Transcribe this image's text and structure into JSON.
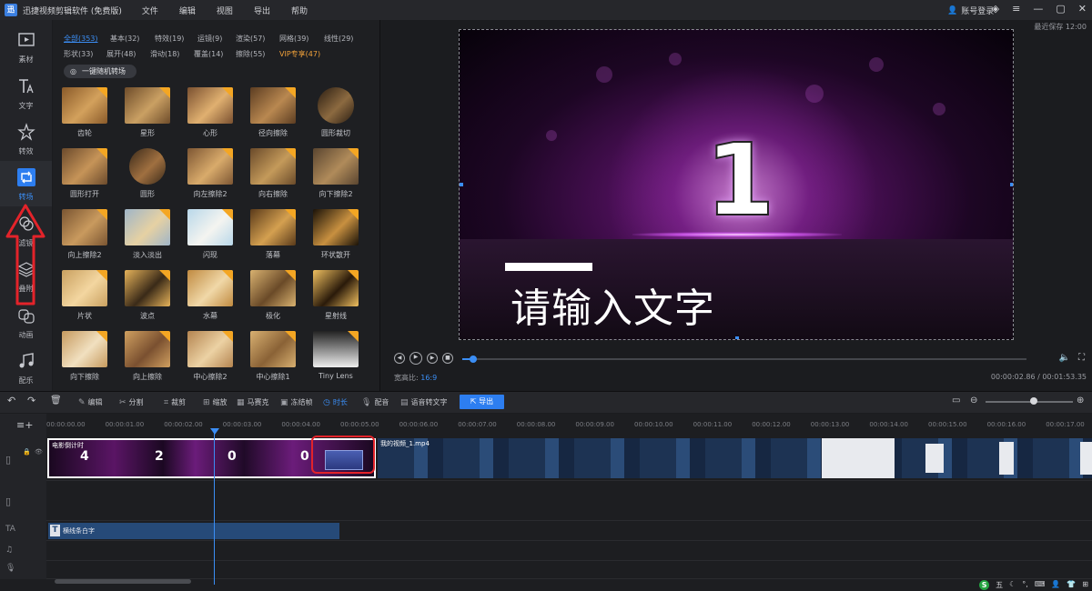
{
  "titlebar": {
    "app_title": "迅捷视频剪辑软件 (免费版)",
    "menu": [
      "文件",
      "编辑",
      "视图",
      "导出",
      "帮助"
    ],
    "login": "账号登录"
  },
  "sidebar": {
    "items": [
      {
        "label": "素材",
        "icon": "media-icon"
      },
      {
        "label": "文字",
        "icon": "text-icon"
      },
      {
        "label": "转效",
        "icon": "effect-icon"
      },
      {
        "label": "转场",
        "icon": "transition-icon",
        "active": true
      },
      {
        "label": "滤镜",
        "icon": "filter-icon"
      },
      {
        "label": "叠附",
        "icon": "overlay-icon"
      },
      {
        "label": "动画",
        "icon": "animation-icon"
      },
      {
        "label": "配乐",
        "icon": "music-icon"
      }
    ]
  },
  "panel": {
    "categories": [
      {
        "label": "全部(353)",
        "selected": true
      },
      {
        "label": "基本(32)"
      },
      {
        "label": "特效(19)"
      },
      {
        "label": "运镜(9)"
      },
      {
        "label": "渲染(57)"
      },
      {
        "label": "网格(39)"
      },
      {
        "label": "线性(29)"
      },
      {
        "label": "形状(33)"
      },
      {
        "label": "展开(48)"
      },
      {
        "label": "滑动(18)"
      },
      {
        "label": "覆盖(14)"
      },
      {
        "label": "擦除(55)"
      },
      {
        "label": "VIP专享(47)",
        "vip": true
      }
    ],
    "onekey_label": "一键随机转场",
    "thumbs": [
      "齿轮",
      "星形",
      "心形",
      "径向擦除",
      "圆形裁切",
      "圆形打开",
      "圆形",
      "向左擦除2",
      "向右擦除",
      "向下擦除2",
      "向上擦除2",
      "淡入淡出",
      "闪现",
      "落幕",
      "环状散开",
      "片状",
      "波点",
      "水幕",
      "极化",
      "星射线",
      "向下擦除",
      "向上擦除",
      "中心擦除2",
      "中心擦除1",
      "Tiny Lens"
    ]
  },
  "preview": {
    "autosave": "最近保存 12:00",
    "big_number": "1",
    "canvas_text": "请输入文字",
    "ratio_label": "宽高比:",
    "ratio_value": "16:9",
    "timecode": "00:00:02.86 / 00:01:53.35",
    "progress": 0.02
  },
  "toolbar": {
    "items": [
      "编辑",
      "分割",
      "裁剪",
      "缩放",
      "马赛克",
      "冻结帧",
      "时长",
      "配音",
      "语音转文字"
    ],
    "export_label": "导出",
    "zoom": 0.55
  },
  "timeline": {
    "ruler": [
      "00:00:00.00",
      "00:00:01.00",
      "00:00:02.00",
      "00:00:03.00",
      "00:00:04.00",
      "00:00:05.00",
      "00:00:06.00",
      "00:00:07.00",
      "00:00:08.00",
      "00:00:09.00",
      "00:00:10.00",
      "00:00:11.00",
      "00:00:12.00",
      "00:00:13.00",
      "00:00:14.00",
      "00:00:15.00",
      "00:00:16.00",
      "00:00:17.00"
    ],
    "clip1_title": "电影倒计时",
    "clip1_numbers": [
      "4",
      "2",
      "0",
      "0"
    ],
    "clip2_title": "我的视频_1.mp4",
    "text_clip_title": "横线条白字",
    "text_clip_icon": "T"
  },
  "tray": {
    "ime": "五"
  }
}
